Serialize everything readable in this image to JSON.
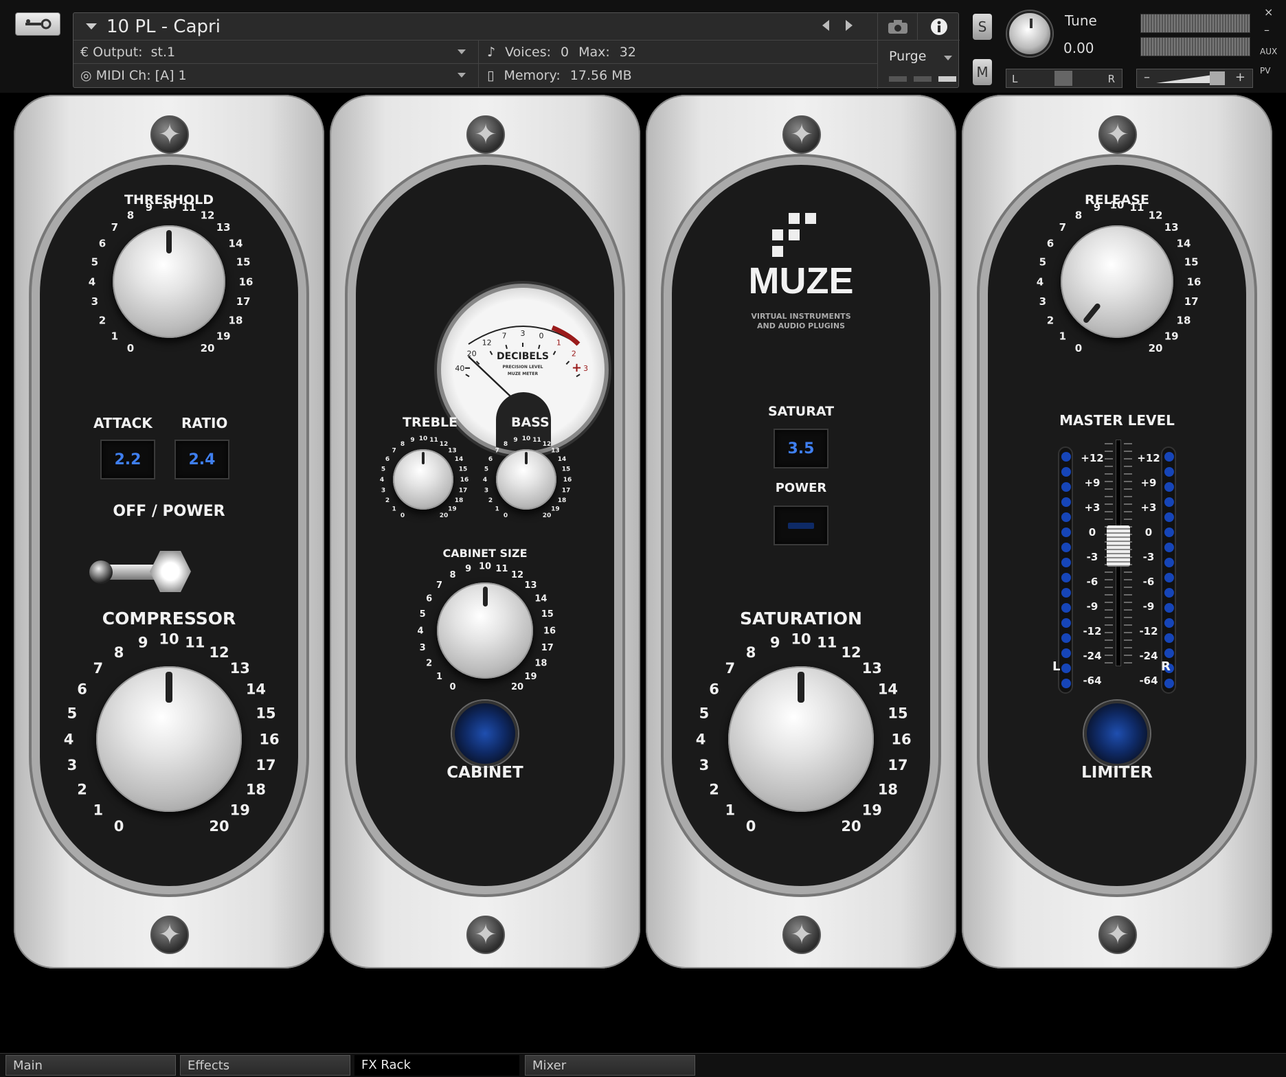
{
  "header": {
    "instrument_name": "10 PL - Capri",
    "output_label": "Output:",
    "output_value": "st.1",
    "midi_label": "MIDI Ch:",
    "midi_value": "[A]  1",
    "voices_label": "Voices:",
    "voices_value": "0",
    "max_label": "Max:",
    "max_value": "32",
    "memory_label": "Memory:",
    "memory_value": "17.56 MB",
    "purge_label": "Purge",
    "solo_label": "S",
    "mute_label": "M",
    "tune_label": "Tune",
    "tune_value": "0.00",
    "pan_left": "L",
    "pan_right": "R",
    "vol_minus": "–",
    "vol_plus": "+",
    "close": "×",
    "minimize": "–",
    "aux_label": "AUX",
    "pv_label": "PV"
  },
  "compressor": {
    "threshold_label": "THRESHOLD",
    "attack_label": "ATTACK",
    "ratio_label": "RATIO",
    "attack_value": "2.2",
    "ratio_value": "2.4",
    "power_label": "OFF / POWER",
    "title": "COMPRESSOR"
  },
  "cabinet": {
    "vu_title": "DECIBELS",
    "vu_sub1": "PRECISION LEVEL",
    "vu_sub2": "MUZE METER",
    "vu_scale": [
      "40",
      "20",
      "12",
      "7",
      "3",
      "0",
      "1",
      "2",
      "3"
    ],
    "vu_minus": "–",
    "vu_plus": "+",
    "treble_label": "TREBLE",
    "bass_label": "BASS",
    "size_label": "CABINET SIZE",
    "title": "CABINET"
  },
  "saturation": {
    "brand": "MUZE",
    "tagline1": "VIRTUAL INSTRUMENTS",
    "tagline2": "AND AUDIO PLUGINS",
    "saturat_label": "SATURAT",
    "saturat_value": "3.5",
    "power_label": "POWER",
    "title": "SATURATION"
  },
  "limiter": {
    "release_label": "RELEASE",
    "master_label": "MASTER LEVEL",
    "scale": [
      "+12",
      "+9",
      "+3",
      "0",
      "-3",
      "-6",
      "-9",
      "-12",
      "-24",
      "-64"
    ],
    "left": "L",
    "right": "R",
    "title": "LIMITER"
  },
  "knob_scale": [
    "0",
    "1",
    "2",
    "3",
    "4",
    "5",
    "6",
    "7",
    "8",
    "9",
    "10",
    "11",
    "12",
    "13",
    "14",
    "15",
    "16",
    "17",
    "18",
    "19",
    "20"
  ],
  "tabs": {
    "main": "Main",
    "effects": "Effects",
    "fxrack": "FX Rack",
    "mixer": "Mixer"
  },
  "colors": {
    "display_blue": "#3f7ff0",
    "led_blue": "#1645b8",
    "panel_dark": "#1a1a1a"
  }
}
